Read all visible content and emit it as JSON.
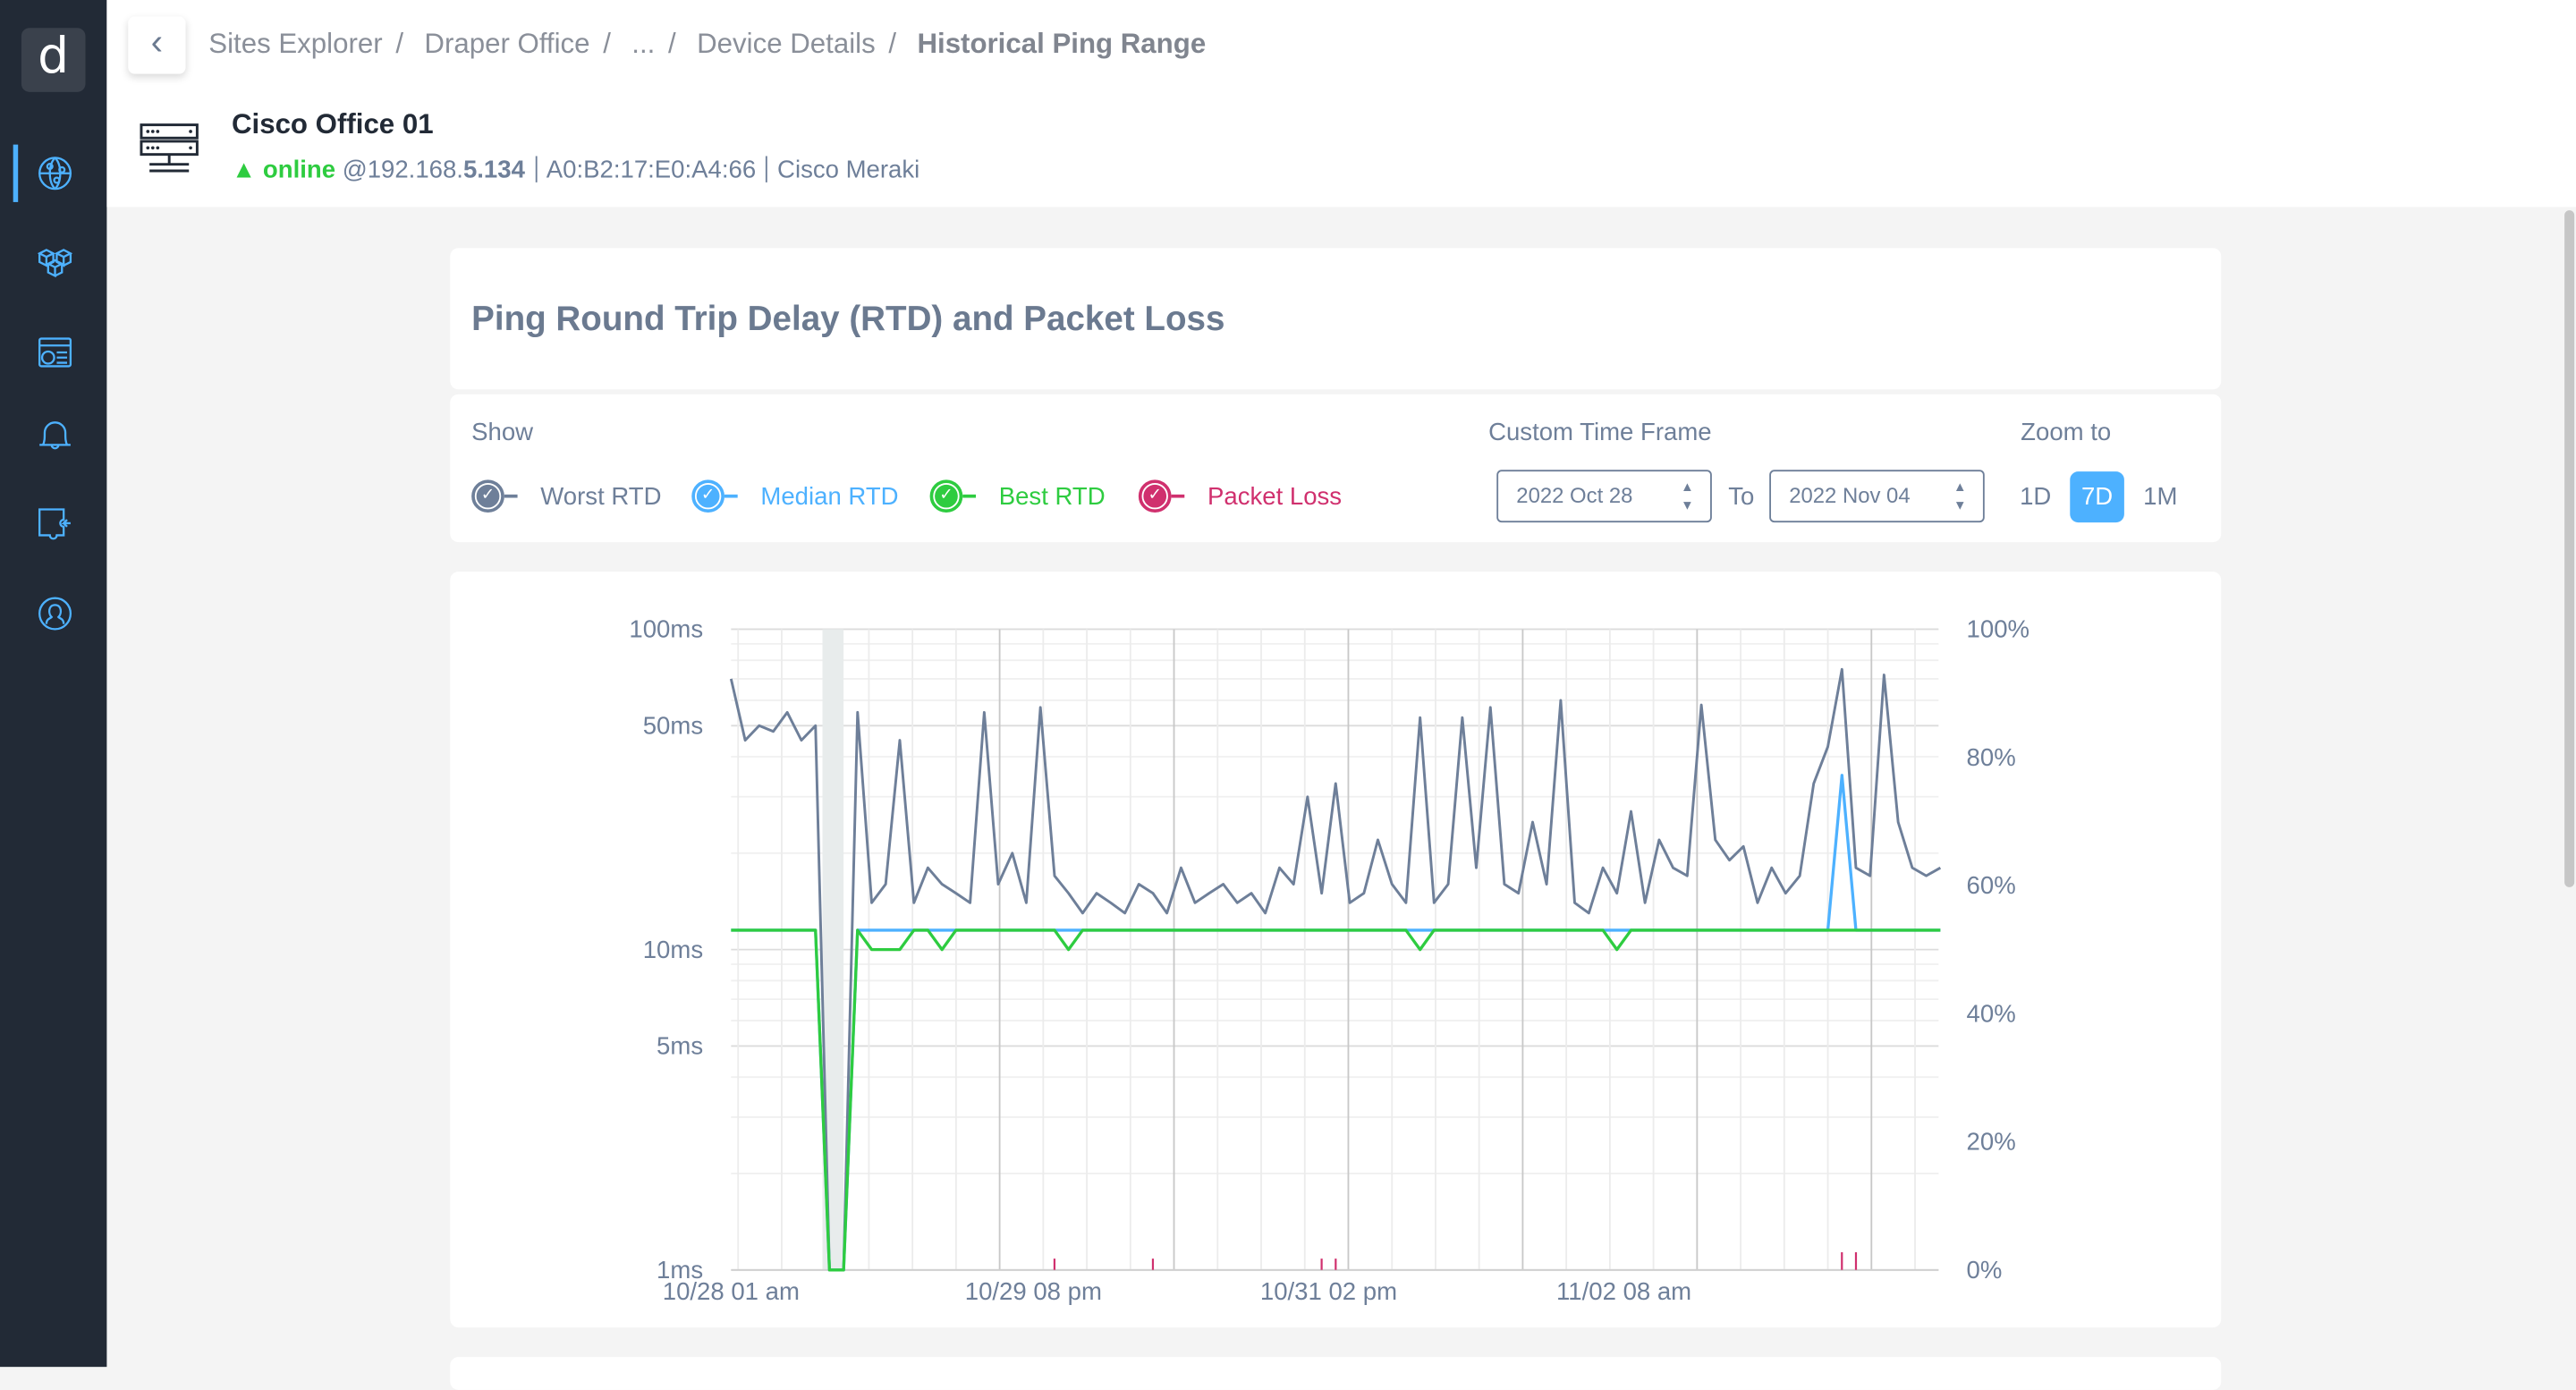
{
  "sidebar": {
    "logo": "d",
    "items": [
      {
        "icon": "globe-network-icon",
        "active": true
      },
      {
        "icon": "cubes-icon"
      },
      {
        "icon": "dashboard-icon"
      },
      {
        "icon": "bell-icon"
      },
      {
        "icon": "puzzle-icon"
      },
      {
        "icon": "user-circle-icon"
      }
    ],
    "accent": "#4db1ff"
  },
  "breadcrumb": [
    "Sites Explorer",
    "Draper Office",
    "...",
    "Device Details",
    "Historical Ping Range"
  ],
  "device": {
    "name": "Cisco Office 01",
    "status": "online",
    "ip_prefix": "@192.168.",
    "ip_suffix": "5.134",
    "mac": "A0:B2:17:E0:A4:66",
    "vendor": "Cisco Meraki"
  },
  "card_title": "Ping Round Trip Delay (RTD) and Packet Loss",
  "controls": {
    "show_label": "Show",
    "legend": [
      {
        "label": "Worst RTD",
        "color": "#6e7f99",
        "checked": true
      },
      {
        "label": "Median RTD",
        "color": "#4db1ff",
        "checked": true
      },
      {
        "label": "Best RTD",
        "color": "#2ecc40",
        "checked": true
      },
      {
        "label": "Packet Loss",
        "color": "#d0306e",
        "checked": true
      }
    ],
    "time_frame_label": "Custom Time Frame",
    "from": "2022 Oct 28",
    "to_label": "To",
    "to": "2022 Nov 04",
    "zoom_label": "Zoom to",
    "zoom_options": [
      "1D",
      "7D",
      "1M"
    ],
    "zoom_selected": "7D"
  },
  "chart_data": {
    "type": "line",
    "y_left": {
      "scale": "log",
      "range": [
        1,
        100
      ],
      "ticks": [
        "100ms",
        "50ms",
        "10ms",
        "5ms",
        "1ms"
      ],
      "tick_values": [
        100,
        50,
        10,
        5,
        1
      ]
    },
    "y_right": {
      "range": [
        0,
        100
      ],
      "ticks": [
        "100%",
        "80%",
        "60%",
        "40%",
        "20%",
        "0%"
      ],
      "tick_values": [
        100,
        80,
        60,
        40,
        20,
        0
      ]
    },
    "x_ticks": [
      "10/28 01 am",
      "10/29 08 pm",
      "10/31 02 pm",
      "11/02 08 am"
    ],
    "x_tick_values": [
      "10/28 01:00",
      "10/29 20:00",
      "10/31 14:00",
      "11/02 08:00"
    ],
    "highlight_range": [
      "10/28 14:00",
      "10/28 17:00"
    ],
    "grid": true,
    "x": [
      "10/28 01:00",
      "10/28 03:00",
      "10/28 05:00",
      "10/28 07:00",
      "10/28 09:00",
      "10/28 11:00",
      "10/28 13:00",
      "10/28 15:00",
      "10/28 17:00",
      "10/28 19:00",
      "10/28 21:00",
      "10/28 23:00",
      "10/29 01:00",
      "10/29 03:00",
      "10/29 05:00",
      "10/29 07:00",
      "10/29 09:00",
      "10/29 11:00",
      "10/29 13:00",
      "10/29 15:00",
      "10/29 17:00",
      "10/29 19:00",
      "10/29 21:00",
      "10/29 23:00",
      "10/30 01:00",
      "10/30 03:00",
      "10/30 05:00",
      "10/30 07:00",
      "10/30 09:00",
      "10/30 11:00",
      "10/30 13:00",
      "10/30 15:00",
      "10/30 17:00",
      "10/30 19:00",
      "10/30 21:00",
      "10/30 23:00",
      "10/31 01:00",
      "10/31 03:00",
      "10/31 05:00",
      "10/31 07:00",
      "10/31 09:00",
      "10/31 11:00",
      "10/31 13:00",
      "10/31 15:00",
      "10/31 17:00",
      "10/31 19:00",
      "10/31 21:00",
      "10/31 23:00",
      "11/01 01:00",
      "11/01 03:00",
      "11/01 05:00",
      "11/01 07:00",
      "11/01 09:00",
      "11/01 11:00",
      "11/01 13:00",
      "11/01 15:00",
      "11/01 17:00",
      "11/01 19:00",
      "11/01 21:00",
      "11/01 23:00",
      "11/02 01:00",
      "11/02 03:00",
      "11/02 05:00",
      "11/02 07:00",
      "11/02 09:00",
      "11/02 11:00",
      "11/02 13:00",
      "11/02 15:00",
      "11/02 17:00",
      "11/02 19:00",
      "11/02 21:00",
      "11/02 23:00",
      "11/03 01:00",
      "11/03 03:00",
      "11/03 05:00",
      "11/03 07:00",
      "11/03 09:00",
      "11/03 11:00",
      "11/03 13:00",
      "11/03 15:00",
      "11/03 17:00",
      "11/03 19:00",
      "11/03 21:00",
      "11/03 23:00",
      "11/04 01:00",
      "11/04 03:00",
      "11/04 05:00"
    ],
    "series": [
      {
        "name": "Worst RTD",
        "axis": "left",
        "color": "#6e7f99",
        "values": [
          70,
          45,
          50,
          48,
          55,
          45,
          50,
          1,
          1,
          55,
          14,
          16,
          45,
          14,
          18,
          16,
          15,
          14,
          55,
          16,
          20,
          14,
          57,
          17,
          15,
          13,
          15,
          14,
          13,
          16,
          15,
          13,
          18,
          14,
          15,
          16,
          14,
          15,
          13,
          18,
          16,
          30,
          15,
          33,
          14,
          15,
          22,
          16,
          14,
          53,
          14,
          16,
          53,
          18,
          57,
          16,
          15,
          25,
          16,
          60,
          14,
          13,
          18,
          15,
          27,
          14,
          22,
          18,
          17,
          58,
          22,
          19,
          21,
          14,
          18,
          15,
          17,
          33,
          43,
          75,
          18,
          17,
          72,
          25,
          18,
          17,
          18
        ]
      },
      {
        "name": "Median RTD",
        "axis": "left",
        "color": "#4db1ff",
        "values": [
          11.5,
          11.5,
          11.5,
          11.5,
          11.5,
          11.5,
          11.5,
          1,
          1,
          11.5,
          11.5,
          11.5,
          11.5,
          11.5,
          11.5,
          11.5,
          11.5,
          11.5,
          11.5,
          11.5,
          11.5,
          11.5,
          11.5,
          11.5,
          11.5,
          11.5,
          11.5,
          11.5,
          11.5,
          11.5,
          11.5,
          11.5,
          11.5,
          11.5,
          11.5,
          11.5,
          11.5,
          11.5,
          11.5,
          11.5,
          11.5,
          11.5,
          11.5,
          11.5,
          11.5,
          11.5,
          11.5,
          11.5,
          11.5,
          11.5,
          11.5,
          11.5,
          11.5,
          11.5,
          11.5,
          11.5,
          11.5,
          11.5,
          11.5,
          11.5,
          11.5,
          11.5,
          11.5,
          11.5,
          11.5,
          11.5,
          11.5,
          11.5,
          11.5,
          11.5,
          11.5,
          11.5,
          11.5,
          11.5,
          11.5,
          11.5,
          11.5,
          11.5,
          11.5,
          35,
          11.5,
          11.5,
          11.5,
          11.5,
          11.5,
          11.5,
          11.5
        ]
      },
      {
        "name": "Best RTD",
        "axis": "left",
        "color": "#2ecc40",
        "values": [
          11.5,
          11.5,
          11.5,
          11.5,
          11.5,
          11.5,
          11.5,
          1,
          1,
          11.5,
          10,
          10,
          10,
          11.5,
          11.5,
          10,
          11.5,
          11.5,
          11.5,
          11.5,
          11.5,
          11.5,
          11.5,
          11.5,
          10,
          11.5,
          11.5,
          11.5,
          11.5,
          11.5,
          11.5,
          11.5,
          11.5,
          11.5,
          11.5,
          11.5,
          11.5,
          11.5,
          11.5,
          11.5,
          11.5,
          11.5,
          11.5,
          11.5,
          11.5,
          11.5,
          11.5,
          11.5,
          11.5,
          10,
          11.5,
          11.5,
          11.5,
          11.5,
          11.5,
          11.5,
          11.5,
          11.5,
          11.5,
          11.5,
          11.5,
          11.5,
          11.5,
          10,
          11.5,
          11.5,
          11.5,
          11.5,
          11.5,
          11.5,
          11.5,
          11.5,
          11.5,
          11.5,
          11.5,
          11.5,
          11.5,
          11.5,
          11.5,
          11.5,
          11.5,
          11.5,
          11.5,
          11.5,
          11.5,
          11.5,
          11.5
        ]
      },
      {
        "name": "Packet Loss",
        "axis": "right",
        "color": "#d0306e",
        "values": [
          0,
          0,
          0,
          0,
          0,
          0,
          0,
          0,
          0,
          0,
          0,
          0,
          0,
          0,
          0,
          0,
          0,
          0,
          0,
          0,
          0,
          0,
          0,
          1,
          0,
          0,
          0,
          0,
          0,
          0,
          1,
          0,
          0,
          0,
          0,
          0,
          0,
          0,
          0,
          0,
          0,
          0,
          1,
          1,
          0,
          0,
          0,
          0,
          0,
          0,
          0,
          0,
          0,
          0,
          0,
          0,
          0,
          0,
          0,
          0,
          0,
          0,
          0,
          0,
          0,
          0,
          0,
          0,
          0,
          0,
          0,
          0,
          0,
          0,
          0,
          0,
          0,
          0,
          0,
          2,
          2,
          0,
          0,
          0,
          0,
          0,
          0
        ]
      }
    ]
  }
}
